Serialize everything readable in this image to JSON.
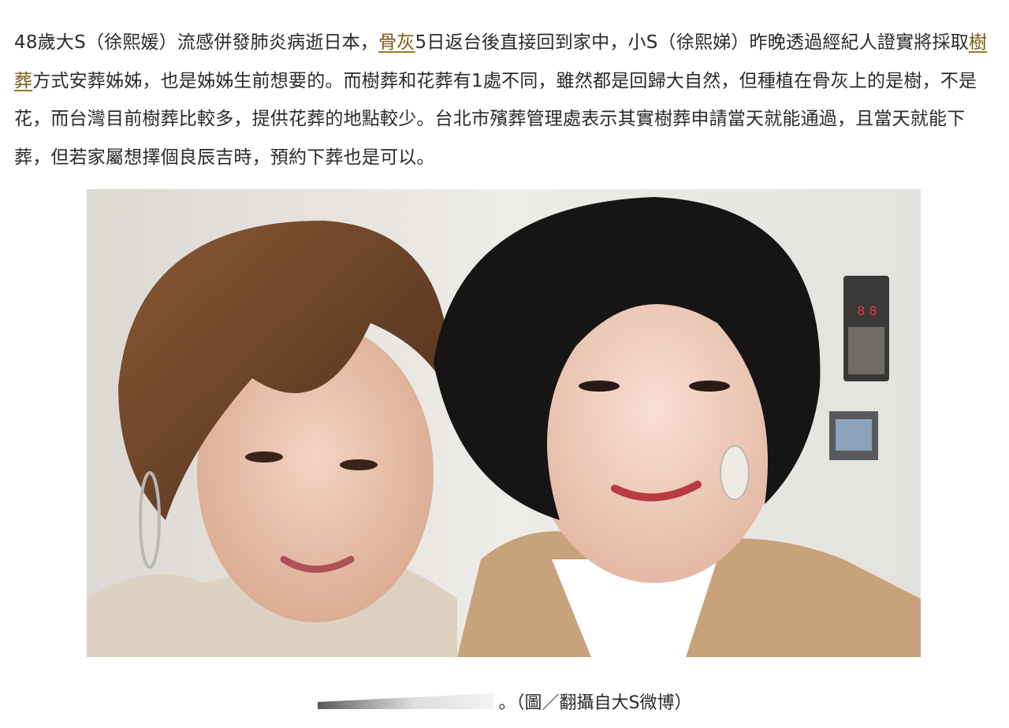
{
  "article": {
    "seg1": "48歲大S（徐熙媛）流感併發肺炎病逝日本，",
    "link1": "骨灰",
    "seg2": "5日返台後直接回到家中，小S（徐熙娣）昨晚透過經紀人證實將採取",
    "link2": "樹葬",
    "seg3": "方式安葬姊姊，也是姊姊生前想要的。而樹葬和花葬有1處不同，雖然都是回歸大自然，但種植在骨灰上的是樹，不是花，而台灣目前樹葬比較多，提供花葬的地點較少。台北市殯葬管理處表示其實樹葬申請當天就能通過，且當天就能下葬，但若家屬想擇個良辰吉時，預約下葬也是可以。"
  },
  "caption": {
    "text": "。（圖／翻攝自大S微博）"
  },
  "colors": {
    "link": "#7a5a16",
    "text": "#2a2a2a"
  }
}
